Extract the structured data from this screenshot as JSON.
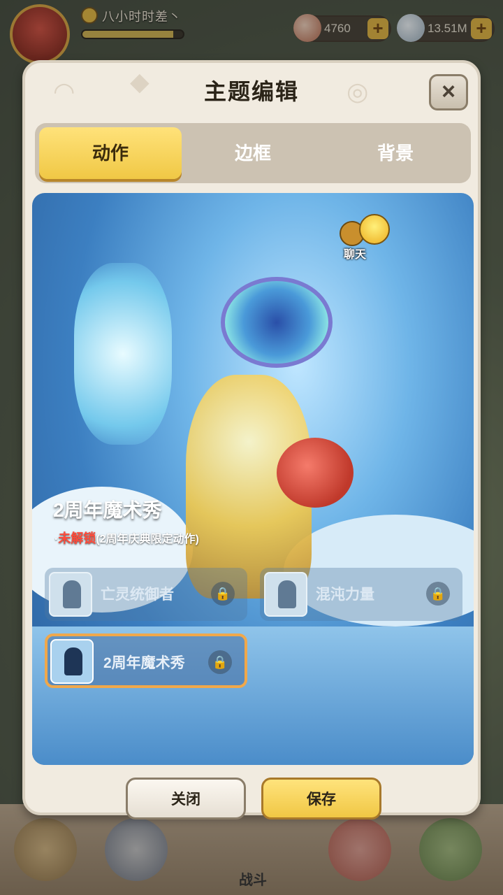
{
  "hud": {
    "player_name": "八小时时差丶",
    "xp_progress": 0.9,
    "currency_1": "4760",
    "currency_2": "13.51M",
    "plus": "+"
  },
  "bottom_nav": {
    "battle_label": "战斗"
  },
  "modal": {
    "title": "主题编辑",
    "close_icon": "×",
    "tabs": [
      {
        "label": "动作",
        "active": true
      },
      {
        "label": "边框",
        "active": false
      },
      {
        "label": "背景",
        "active": false
      }
    ],
    "preview": {
      "chat_label": "聊天",
      "action_name": "2周年魔术秀",
      "status_prefix": "·",
      "status_locked": "未解锁",
      "status_detail": "(2周年庆典限定动作)"
    },
    "actions": [
      {
        "label": "亡灵统御者",
        "locked": true,
        "selected": false
      },
      {
        "label": "混沌力量",
        "locked": true,
        "selected": false
      },
      {
        "label": "2周年魔术秀",
        "locked": true,
        "selected": true
      }
    ],
    "lock_icon": "🔒",
    "buttons": {
      "close": "关闭",
      "save": "保存"
    }
  },
  "colors": {
    "tab_active": "#f0c845",
    "save_button": "#f0c744",
    "locked_text": "#ff4a3a",
    "selected_border": "#f0a84b"
  }
}
